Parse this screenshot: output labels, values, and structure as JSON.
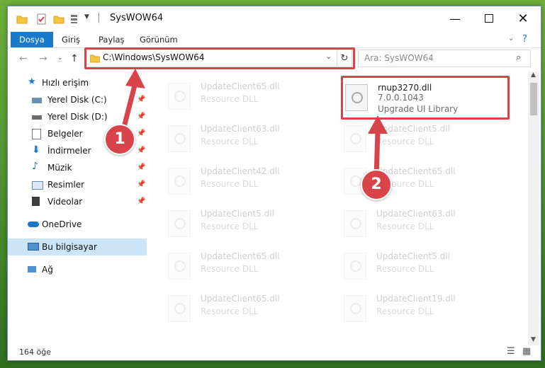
{
  "window": {
    "title": "SysWOW64",
    "controls": [
      "minimize",
      "maximize",
      "close"
    ]
  },
  "ribbon": {
    "tabs": [
      "Dosya",
      "Giriş",
      "Paylaş",
      "Görünüm"
    ]
  },
  "address": {
    "path": "C:\\Windows\\SysWOW64",
    "search_placeholder": "Ara: SysWOW64"
  },
  "nav": {
    "items": [
      {
        "label": "Hızlı erişim",
        "icon": "star-icon",
        "pinned": false
      },
      {
        "label": "Yerel Disk (C:)",
        "icon": "drive-icon",
        "pinned": true
      },
      {
        "label": "Yerel Disk (D:)",
        "icon": "drive-icon",
        "pinned": true
      },
      {
        "label": "Belgeler",
        "icon": "documents-icon",
        "pinned": true
      },
      {
        "label": "İndirmeler",
        "icon": "download-icon",
        "pinned": true
      },
      {
        "label": "Müzik",
        "icon": "music-icon",
        "pinned": true
      },
      {
        "label": "Resimler",
        "icon": "pictures-icon",
        "pinned": true
      },
      {
        "label": "Videolar",
        "icon": "video-icon",
        "pinned": true
      },
      {
        "label": "OneDrive",
        "icon": "cloud-icon",
        "pinned": false
      },
      {
        "label": "Bu bilgisayar",
        "icon": "computer-icon",
        "pinned": false,
        "selected": true
      },
      {
        "label": "Ağ",
        "icon": "network-icon",
        "pinned": false
      }
    ]
  },
  "files": {
    "highlighted": {
      "name": "rnup3270.dll",
      "version": "7.0.0.1043",
      "description": "Upgrade UI Library"
    },
    "left_column": [
      {
        "name": "UpdateClient65.dll",
        "description": "Resource DLL"
      },
      {
        "name": "UpdateClient63.dll",
        "description": "Resource DLL"
      },
      {
        "name": "UpdateClient42.dll",
        "description": "Resource DLL"
      },
      {
        "name": "UpdateClient5.dll",
        "description": "Resource DLL"
      },
      {
        "name": "UpdateClient65.dll",
        "description": "Resource DLL"
      },
      {
        "name": "UpdateClient65.dll",
        "description": "Resource DLL"
      }
    ],
    "right_column": [
      {
        "name": "UpdateClient5.dll",
        "description": "Resource DLL"
      },
      {
        "name": "UpdateClient65.dll",
        "description": "Resource DLL"
      },
      {
        "name": "UpdateClient63.dll",
        "description": "Resource DLL"
      },
      {
        "name": "UpdateClient5.dll",
        "description": "Resource DLL"
      },
      {
        "name": "UpdateClient19.dll",
        "description": "Resource DLL"
      }
    ]
  },
  "status": {
    "item_count": "164 öğe"
  },
  "annotations": {
    "badge1": "1",
    "badge2": "2",
    "color": "#d9434a"
  },
  "colors": {
    "accent": "#1979ca",
    "selected_nav": "#cce4f7"
  }
}
